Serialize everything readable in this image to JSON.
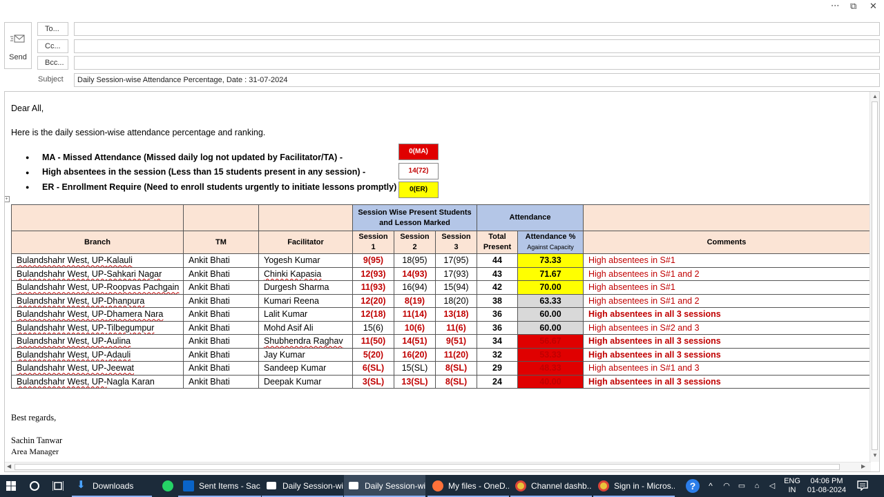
{
  "window": {
    "more": "···",
    "restore": "⧉",
    "close": "✕"
  },
  "send_label": "Send",
  "to_label": "To...",
  "cc_label": "Cc...",
  "bcc_label": "Bcc...",
  "subject_label": "Subject",
  "subject_value": "Daily Session-wise Attendance Percentage, Date : 31-07-2024",
  "greeting": "Dear All,",
  "intro": "Here is the daily session-wise attendance percentage and ranking.",
  "legend": [
    {
      "text": "MA - Missed Attendance (Missed daily log not updated by Facilitator/TA)  -",
      "box": "0(MA)",
      "color": "#e00000",
      "textcolor": "#ffffff"
    },
    {
      "text": "High absentees in the session (Less than 15 students present in any session) -",
      "box": "14(72)",
      "color": "#ffffff",
      "textcolor": "#c00000"
    },
    {
      "text": "ER - Enrollment Require (Need to enroll students urgently to initiate lessons promptly) -",
      "box": "0(ER)",
      "color": "#ffff00",
      "textcolor": "#000000"
    }
  ],
  "table": {
    "group_session": "Session Wise Present Students and Lesson Marked",
    "group_attendance": "Attendance",
    "headers": {
      "branch": "Branch",
      "tm": "TM",
      "facilitator": "Facilitator",
      "s1a": "Session",
      "s1b": "1",
      "s2a": "Session",
      "s2b": "2",
      "s3a": "Session",
      "s3b": "3",
      "total_a": "Total",
      "total_b": "Present",
      "pct_a": "Attendance %",
      "pct_b": "Against Capacity",
      "comments": "Comments"
    },
    "rows": [
      {
        "branch_pre": "Bulandshahr West, UP-",
        "branch_name": "Kalauli",
        "tm": "Ankit Bhati",
        "facilitator": "Yogesh Kumar",
        "s1": "9(95)",
        "s2": "18(95)",
        "s3": "17(95)",
        "total": "44",
        "pct": "73.33",
        "comment": "High absentees in S#1"
      },
      {
        "branch_pre": "Bulandshahr West, UP-",
        "branch_name": "Sahkari Nagar",
        "tm": "Ankit Bhati",
        "facilitator": "Chinki Kapasia",
        "s1": "12(93)",
        "s2": "14(93)",
        "s3": "17(93)",
        "total": "43",
        "pct": "71.67",
        "comment": "High absentees in S#1 and 2"
      },
      {
        "branch_pre": "Bulandshahr West, UP-",
        "branch_name": "Roopvas Pachgain",
        "tm": "Ankit Bhati",
        "facilitator": "Durgesh Sharma",
        "s1": "11(93)",
        "s2": "16(94)",
        "s3": "15(94)",
        "total": "42",
        "pct": "70.00",
        "comment": "High absentees in S#1"
      },
      {
        "branch_pre": "Bulandshahr West, UP-",
        "branch_name": "Dhanpura",
        "tm": "Ankit Bhati",
        "facilitator": "Kumari Reena",
        "s1": "12(20)",
        "s2": "8(19)",
        "s3": "18(20)",
        "total": "38",
        "pct": "63.33",
        "comment": "High absentees in S#1 and 2"
      },
      {
        "branch_pre": "Bulandshahr West, UP-",
        "branch_name": "Dhamera Nara",
        "tm": "Ankit Bhati",
        "facilitator": "Lalit Kumar",
        "s1": "12(18)",
        "s2": "11(14)",
        "s3": "13(18)",
        "total": "36",
        "pct": "60.00",
        "comment": "High absentees in all 3 sessions"
      },
      {
        "branch_pre": "Bulandshahr West, UP-",
        "branch_name": "Tilbegumpur",
        "tm": "Ankit Bhati",
        "facilitator": "Mohd Asif Ali",
        "s1": "15(6)",
        "s2": "10(6)",
        "s3": "11(6)",
        "total": "36",
        "pct": "60.00",
        "comment": "High absentees in S#2 and 3"
      },
      {
        "branch_pre": "Bulandshahr West, UP-",
        "branch_name": "Aulina",
        "tm": "Ankit Bhati",
        "facilitator": "Shubhendra Raghav",
        "s1": "11(50)",
        "s2": "14(51)",
        "s3": "9(51)",
        "total": "34",
        "pct": "56.67",
        "comment": "High absentees in all 3 sessions"
      },
      {
        "branch_pre": "Bulandshahr West, UP-",
        "branch_name": "Adauli",
        "tm": "Ankit Bhati",
        "facilitator": "Jay Kumar",
        "s1": "5(20)",
        "s2": "16(20)",
        "s3": "11(20)",
        "total": "32",
        "pct": "53.33",
        "comment": "High absentees in all 3 sessions"
      },
      {
        "branch_pre": "Bulandshahr West, UP-",
        "branch_name": "Jeewat",
        "tm": "Ankit Bhati",
        "facilitator": "Sandeep Kumar",
        "s1": "6(SL)",
        "s2": "15(SL)",
        "s3": "8(SL)",
        "total": "29",
        "pct": "48.33",
        "comment": "High absentees in S#1 and 3"
      },
      {
        "branch_pre": "Bulandshahr West, UP-",
        "branch_name": "Nagla Karan",
        "tm": "Ankit Bhati",
        "facilitator": "Deepak Kumar",
        "s1": "3(SL)",
        "s2": "13(SL)",
        "s3": "8(SL)",
        "total": "24",
        "pct": "40.00",
        "comment": "High absentees in all 3 sessions"
      }
    ]
  },
  "closing": "Best regards,",
  "sender_name": "Sachin Tanwar",
  "sender_title": "Area Manager",
  "taskbar": {
    "items": [
      "Downloads",
      "Sent Items - Sac...",
      "Daily Session-wi...",
      "Daily Session-wi...",
      "My files - OneD...",
      "Channel dashb...",
      "Sign in - Micros..."
    ],
    "lang_top": "ENG",
    "lang_bottom": "IN",
    "time": "04:06 PM",
    "date": "01-08-2024"
  }
}
